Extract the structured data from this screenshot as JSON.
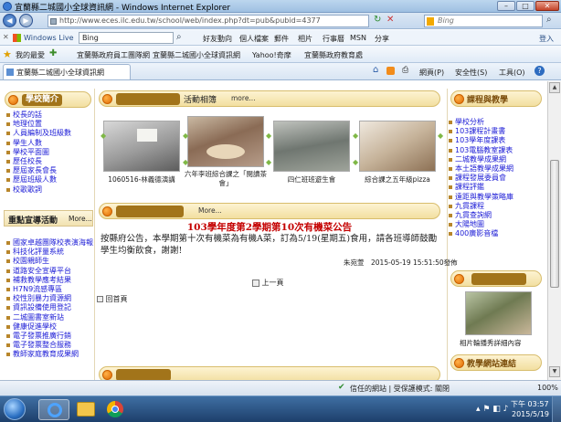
{
  "window": {
    "title": "宜蘭縣二城國小全球資訊網 - Windows Internet Explorer",
    "controls": [
      "minimize",
      "maximize",
      "close"
    ]
  },
  "address": {
    "url": "http://www.eces.ilc.edu.tw/school/web/index.php?dt=pub&pubid=4377",
    "search_placeholder": "Bing"
  },
  "livebar": {
    "brand": "Windows Live",
    "search_value": "Bing",
    "links": [
      "好友動向",
      "個人檔案",
      "郵件",
      "相片",
      "行事曆",
      "MSN",
      "分享"
    ],
    "signin": "登入"
  },
  "favorites": {
    "label": "我的最愛",
    "items": [
      "宜蘭縣政府員工團隊網",
      "宜蘭縣二城國小全球資訊網",
      "Yahoo!奇摩",
      "宜蘭縣政府教育處"
    ]
  },
  "tab": {
    "label": "宜蘭縣二城國小全球資訊網",
    "tools": [
      "網頁(P)",
      "安全性(S)",
      "工具(O)"
    ]
  },
  "left": {
    "section1_title": "學校簡介",
    "section1_items": [
      "校長的話",
      "地理位置",
      "人員編制及班級數",
      "學生人數",
      "學校平面圖",
      "歷任校長",
      "歷屆家長會長",
      "歷屆班級人數",
      "校歌歌詞"
    ],
    "section2_title": "重點宣導活動",
    "section2_more": "More...",
    "section2_items": [
      "國家卓越團隊校表演海報",
      "科技化評量系統",
      "校園親師生",
      "道路安全宣導平台",
      "補救教學應考結果",
      "H7N9流感專區",
      "校性別暴力資源網",
      "資訊設備使用登記",
      "二城圖書室新站",
      "健康促進學校",
      "電子發票推廣行銷",
      "電子發票整合服務",
      "教師家庭教育成果網"
    ]
  },
  "album": {
    "title": "活動相簿",
    "more": "more...",
    "photos": [
      {
        "caption": "1060516-林義德演講"
      },
      {
        "caption": "六年李班綜合課之「閱讀茶會」"
      },
      {
        "caption": "四仁班班遊生會"
      },
      {
        "caption": "綜合課之五年級pizza"
      }
    ]
  },
  "news": {
    "more": "More...",
    "headline": "103學年度第2學期第10次有機菜公告",
    "body": "按縣府公告，本學期第十次有機菜為有機A菜，訂為5/19(星期五)食用，請各班導師鼓勵學生均衡飲食，謝謝!",
    "meta": "朱宛萱　2015-05-19 15:51:50發佈",
    "prev_page": "上一頁",
    "home": "回首頁"
  },
  "right": {
    "section1_title": "課程與教學",
    "section1_items": [
      "學校分析",
      "103課程計畫書",
      "103學年度課表",
      "103電腦教室課表",
      "二城教學成果網",
      "本土語教學成果網",
      "課程發展委員會",
      "課程評鑑",
      "遠距與教學策略庫",
      "九貫課程",
      "九貫查詢網",
      "大陽地圖",
      "400廣影音檔"
    ],
    "photo_caption": "相片輪播秀詳細內容",
    "section2_title": "教學網站連結"
  },
  "status": {
    "zone": "信任的網站 | 受保護模式: 關閉",
    "zoom": "100%"
  },
  "taskbar": {
    "time": "下午 03:57",
    "date": "2015/5/19"
  }
}
